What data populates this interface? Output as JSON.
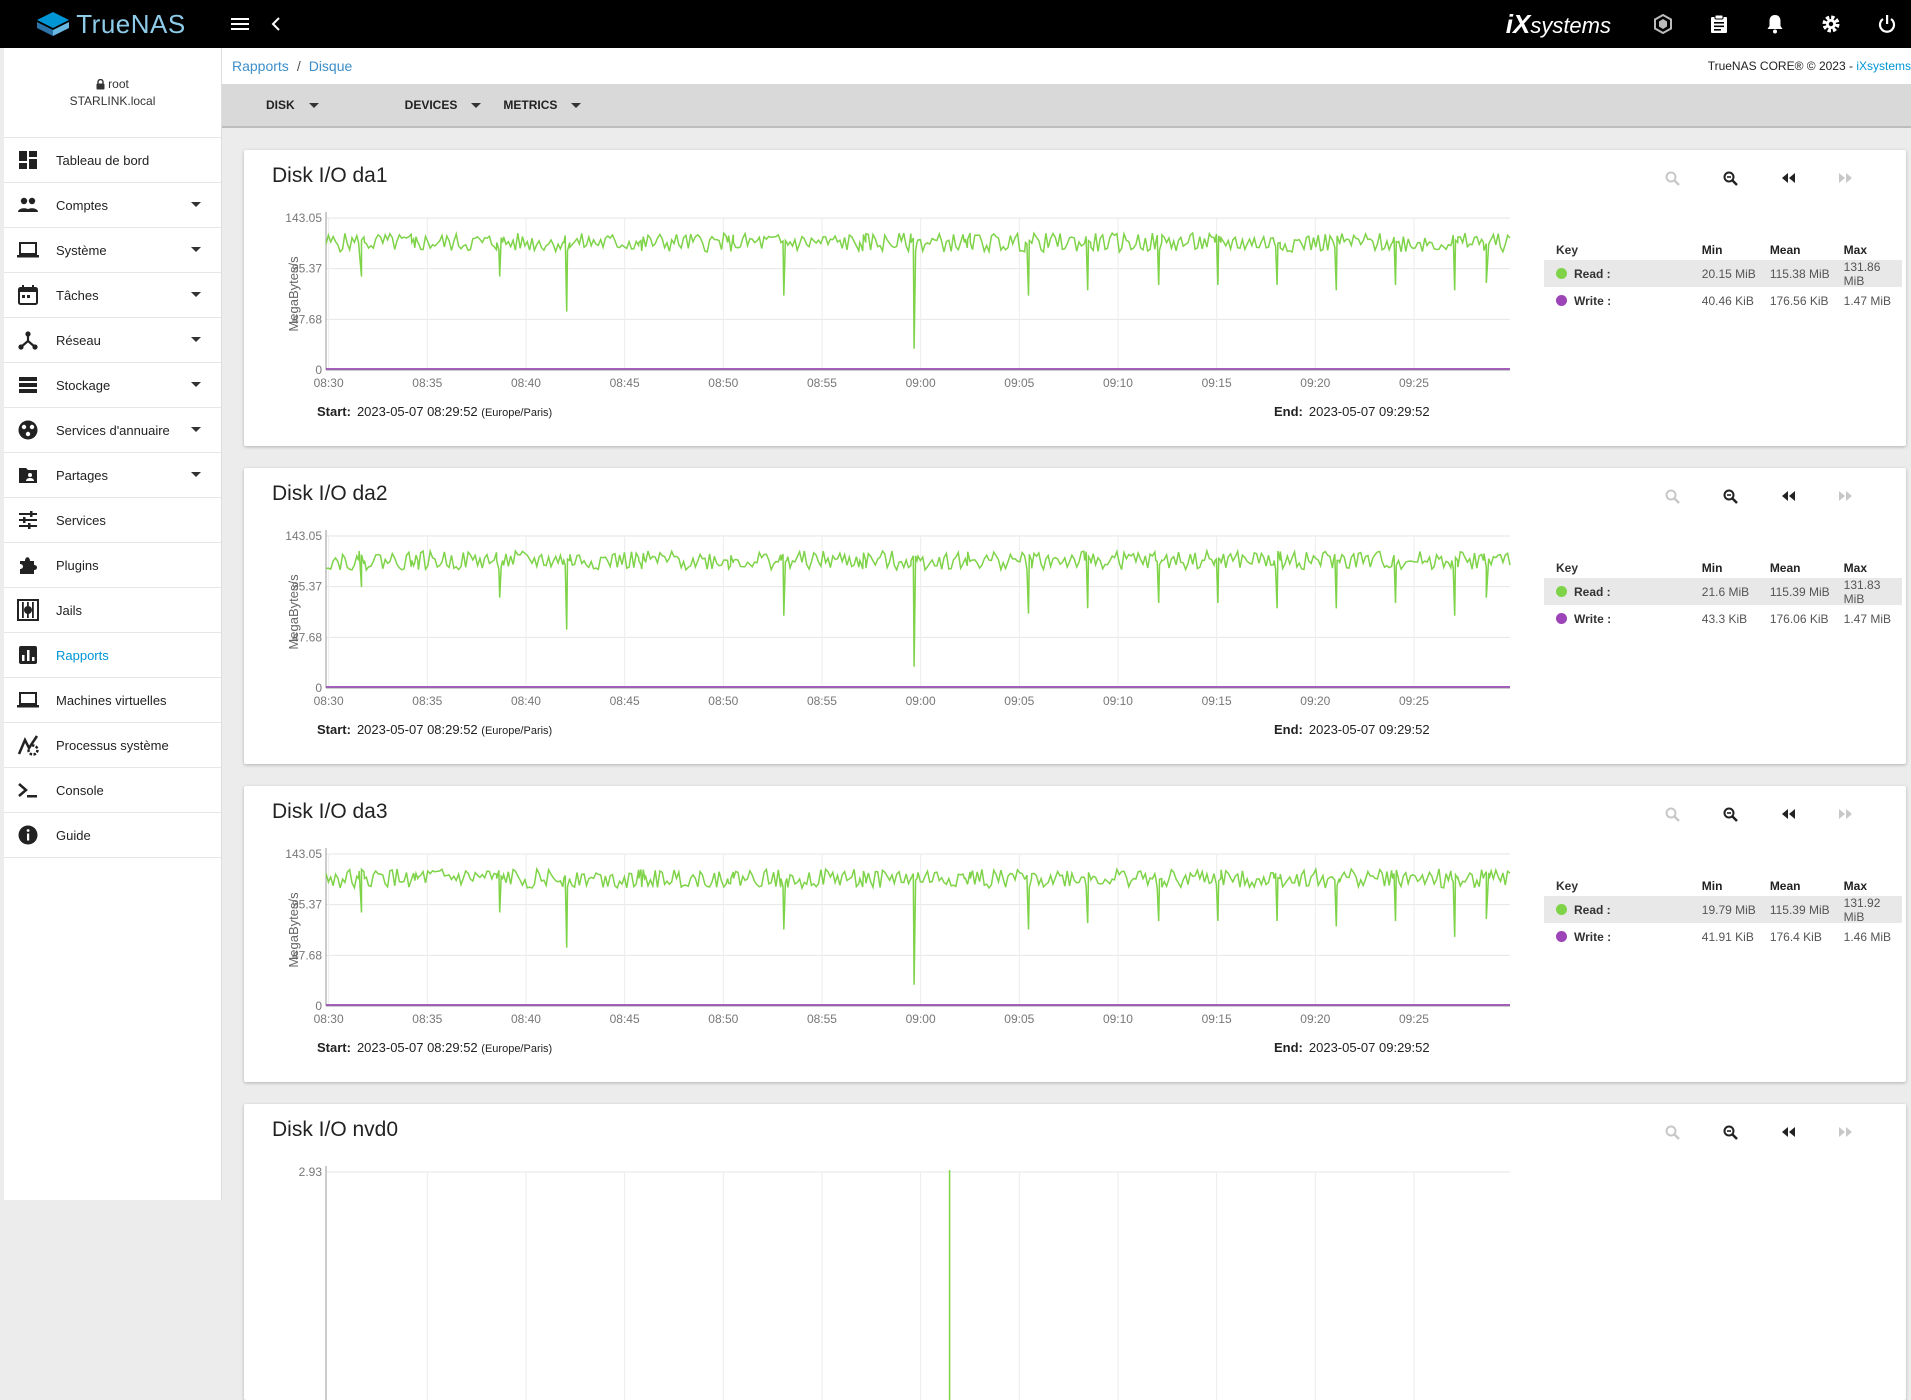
{
  "app": {
    "logo": "TrueNAS",
    "vendor_logo": {
      "i": "iX",
      "rest": "systems"
    }
  },
  "user": {
    "name": "root",
    "host": "STARLINK.local"
  },
  "sidebar": {
    "items": [
      {
        "label": "Tableau de bord",
        "icon": "dashboard-icon",
        "caret": false
      },
      {
        "label": "Comptes",
        "icon": "people-icon",
        "caret": true
      },
      {
        "label": "Système",
        "icon": "laptop-icon",
        "caret": true
      },
      {
        "label": "Tâches",
        "icon": "calendar-icon",
        "caret": true
      },
      {
        "label": "Réseau",
        "icon": "network-icon",
        "caret": true
      },
      {
        "label": "Stockage",
        "icon": "storage-icon",
        "caret": true
      },
      {
        "label": "Services d'annuaire",
        "icon": "directory-icon",
        "caret": true
      },
      {
        "label": "Partages",
        "icon": "shared-folder-icon",
        "caret": true
      },
      {
        "label": "Services",
        "icon": "tune-icon",
        "caret": false
      },
      {
        "label": "Plugins",
        "icon": "puzzle-icon",
        "caret": false
      },
      {
        "label": "Jails",
        "icon": "jail-icon",
        "caret": false
      },
      {
        "label": "Rapports",
        "icon": "bar-chart-icon",
        "caret": false,
        "active": true
      },
      {
        "label": "Machines virtuelles",
        "icon": "computer-icon",
        "caret": false
      },
      {
        "label": "Processus système",
        "icon": "process-icon",
        "caret": false
      },
      {
        "label": "Console",
        "icon": "terminal-icon",
        "caret": false
      },
      {
        "label": "Guide",
        "icon": "info-icon",
        "caret": false
      }
    ]
  },
  "breadcrumb": {
    "root": "Rapports",
    "separator": "/",
    "current": "Disque"
  },
  "copyright": {
    "text": "TrueNAS CORE® © 2023 - ",
    "link": "iXsystems"
  },
  "toolbar": {
    "disk": "DISK",
    "devices": "DEVICES",
    "metrics": "METRICS"
  },
  "colors": {
    "read": "#7ed348",
    "write": "#9c44b8",
    "accent": "#0095d5"
  },
  "legend_header": {
    "key": "Key",
    "min": "Min",
    "mean": "Mean",
    "max": "Max"
  },
  "range_labels": {
    "start": "Start:",
    "end": "End:"
  },
  "cards": [
    {
      "title": "Disk I/O da1",
      "start": "2023-05-07 08:29:52",
      "timezone": "(Europe/Paris)",
      "end": "2023-05-07 09:29:52",
      "legend": [
        {
          "name": "Read :",
          "min": "20.15 MiB",
          "mean": "115.38 MiB",
          "max": "131.86 MiB"
        },
        {
          "name": "Write :",
          "min": "40.46 KiB",
          "mean": "176.56 KiB",
          "max": "1.47 MiB"
        }
      ]
    },
    {
      "title": "Disk I/O da2",
      "start": "2023-05-07 08:29:52",
      "timezone": "(Europe/Paris)",
      "end": "2023-05-07 09:29:52",
      "legend": [
        {
          "name": "Read :",
          "min": "21.6 MiB",
          "mean": "115.39 MiB",
          "max": "131.83 MiB"
        },
        {
          "name": "Write :",
          "min": "43.3 KiB",
          "mean": "176.06 KiB",
          "max": "1.47 MiB"
        }
      ]
    },
    {
      "title": "Disk I/O da3",
      "start": "2023-05-07 08:29:52",
      "timezone": "(Europe/Paris)",
      "end": "2023-05-07 09:29:52",
      "legend": [
        {
          "name": "Read :",
          "min": "19.79 MiB",
          "mean": "115.39 MiB",
          "max": "131.92 MiB"
        },
        {
          "name": "Write :",
          "min": "41.91 KiB",
          "mean": "176.4 KiB",
          "max": "1.46 MiB"
        }
      ]
    },
    {
      "title": "Disk I/O nvd0"
    }
  ],
  "chart_data": [
    {
      "type": "line",
      "title": "Disk I/O da1",
      "ylabel": "MegaBytes/s",
      "yticks": [
        "0",
        "47.68",
        "95.37",
        "143.05"
      ],
      "ylim": [
        0,
        143.05
      ],
      "xticks": [
        "08:30",
        "08:35",
        "08:40",
        "08:45",
        "08:50",
        "08:55",
        "09:00",
        "09:05",
        "09:10",
        "09:15",
        "09:20",
        "09:25"
      ],
      "xlim": [
        "08:29:52",
        "09:29:52"
      ],
      "dips": [
        {
          "t": 1.8,
          "v": 88
        },
        {
          "t": 4.5,
          "v": 115
        },
        {
          "t": 8.8,
          "v": 88
        },
        {
          "t": 12.2,
          "v": 55
        },
        {
          "t": 16,
          "v": 112
        },
        {
          "t": 20.5,
          "v": 115
        },
        {
          "t": 23.2,
          "v": 70
        },
        {
          "t": 27.2,
          "v": 112
        },
        {
          "t": 29.8,
          "v": 20
        },
        {
          "t": 32.5,
          "v": 115
        },
        {
          "t": 35.6,
          "v": 70
        },
        {
          "t": 38.6,
          "v": 75
        },
        {
          "t": 42.2,
          "v": 80
        },
        {
          "t": 45.2,
          "v": 80
        },
        {
          "t": 48.2,
          "v": 80
        },
        {
          "t": 51.2,
          "v": 75
        },
        {
          "t": 54.2,
          "v": 80
        },
        {
          "t": 57.2,
          "v": 75
        },
        {
          "t": 58.8,
          "v": 82
        }
      ],
      "series": [
        {
          "name": "Read",
          "baseline": 120,
          "min": 20.15,
          "mean": 115.38,
          "max": 131.86
        },
        {
          "name": "Write",
          "baseline": 0.17,
          "min": 0.04,
          "mean": 0.17,
          "max": 1.47
        }
      ]
    },
    {
      "type": "line",
      "title": "Disk I/O da2",
      "ylabel": "MegaBytes/s",
      "yticks": [
        "0",
        "47.68",
        "95.37",
        "143.05"
      ],
      "ylim": [
        0,
        143.05
      ],
      "xticks": [
        "08:30",
        "08:35",
        "08:40",
        "08:45",
        "08:50",
        "08:55",
        "09:00",
        "09:05",
        "09:10",
        "09:15",
        "09:20",
        "09:25"
      ],
      "xlim": [
        "08:29:52",
        "09:29:52"
      ],
      "dips": [
        {
          "t": 1.8,
          "v": 95
        },
        {
          "t": 4.5,
          "v": 118
        },
        {
          "t": 8.8,
          "v": 85
        },
        {
          "t": 12.2,
          "v": 55
        },
        {
          "t": 16,
          "v": 112
        },
        {
          "t": 20.5,
          "v": 115
        },
        {
          "t": 23.2,
          "v": 68
        },
        {
          "t": 27.2,
          "v": 112
        },
        {
          "t": 29.8,
          "v": 20
        },
        {
          "t": 32.5,
          "v": 115
        },
        {
          "t": 35.6,
          "v": 70
        },
        {
          "t": 38.6,
          "v": 75
        },
        {
          "t": 42.2,
          "v": 80
        },
        {
          "t": 45.2,
          "v": 80
        },
        {
          "t": 48.2,
          "v": 75
        },
        {
          "t": 51.2,
          "v": 75
        },
        {
          "t": 54.2,
          "v": 80
        },
        {
          "t": 57.2,
          "v": 68
        },
        {
          "t": 58.8,
          "v": 85
        }
      ],
      "series": [
        {
          "name": "Read",
          "baseline": 120,
          "min": 21.6,
          "mean": 115.39,
          "max": 131.83
        },
        {
          "name": "Write",
          "baseline": 0.17,
          "min": 0.04,
          "mean": 0.17,
          "max": 1.47
        }
      ]
    },
    {
      "type": "line",
      "title": "Disk I/O da3",
      "ylabel": "MegaBytes/s",
      "yticks": [
        "0",
        "47.68",
        "95.37",
        "143.05"
      ],
      "ylim": [
        0,
        143.05
      ],
      "xticks": [
        "08:30",
        "08:35",
        "08:40",
        "08:45",
        "08:50",
        "08:55",
        "09:00",
        "09:05",
        "09:10",
        "09:15",
        "09:20",
        "09:25"
      ],
      "xlim": [
        "08:29:52",
        "09:29:52"
      ],
      "dips": [
        {
          "t": 1.8,
          "v": 88
        },
        {
          "t": 4.5,
          "v": 118
        },
        {
          "t": 8.8,
          "v": 88
        },
        {
          "t": 12.2,
          "v": 55
        },
        {
          "t": 16,
          "v": 112
        },
        {
          "t": 20.5,
          "v": 115
        },
        {
          "t": 23.2,
          "v": 72
        },
        {
          "t": 27.2,
          "v": 112
        },
        {
          "t": 29.8,
          "v": 20
        },
        {
          "t": 32.5,
          "v": 115
        },
        {
          "t": 35.6,
          "v": 72
        },
        {
          "t": 38.6,
          "v": 78
        },
        {
          "t": 42.2,
          "v": 80
        },
        {
          "t": 45.2,
          "v": 80
        },
        {
          "t": 48.2,
          "v": 80
        },
        {
          "t": 51.2,
          "v": 75
        },
        {
          "t": 54.2,
          "v": 80
        },
        {
          "t": 57.2,
          "v": 65
        },
        {
          "t": 58.8,
          "v": 82
        }
      ],
      "series": [
        {
          "name": "Read",
          "baseline": 120,
          "min": 19.79,
          "mean": 115.39,
          "max": 131.92
        },
        {
          "name": "Write",
          "baseline": 0.17,
          "min": 0.04,
          "mean": 0.17,
          "max": 1.46
        }
      ]
    },
    {
      "type": "line",
      "title": "Disk I/O nvd0",
      "yticks": [
        "2.93"
      ],
      "ylim": [
        0,
        2.93
      ],
      "xlim": [
        "08:29:52",
        "09:29:52"
      ],
      "spikes": [
        {
          "t": 31.6,
          "v": 2.93
        }
      ]
    }
  ]
}
